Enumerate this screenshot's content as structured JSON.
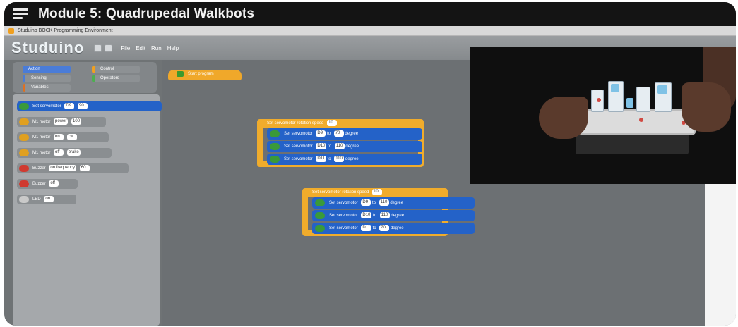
{
  "video": {
    "title": "Module 5: Quadrupedal Walkbots"
  },
  "window": {
    "caption": "Studuino BOCK Programming Environment"
  },
  "toolbar": {
    "brand": "Studuino",
    "menus": [
      "File",
      "Edit",
      "Run",
      "Help"
    ]
  },
  "palette": {
    "categories": [
      "Action",
      "Control",
      "Sensing",
      "Operators",
      "Variables"
    ],
    "blocks": [
      {
        "label": "Set servomotor",
        "slot1": "D9",
        "slot2": "90"
      },
      {
        "label": "M1 motor",
        "slot1": "power",
        "slot2": "100"
      },
      {
        "label": "M1 motor",
        "slot1": "on",
        "slot2": "cw"
      },
      {
        "label": "M1 motor",
        "slot1": "off",
        "slot2": "brake"
      },
      {
        "label": "Buzzer",
        "slot1": "on frequency",
        "slot2": "60"
      },
      {
        "label": "Buzzer",
        "slot1": "off",
        "slot2": ""
      },
      {
        "label": "LED",
        "slot1": "on",
        "slot2": ""
      }
    ]
  },
  "script": {
    "start_label": "Start program",
    "loop1": {
      "label": "Set servomotor rotation speed",
      "value": "10",
      "servos": [
        {
          "label": "Set servomotor",
          "port": "D9",
          "to": "to",
          "angle": "70",
          "unit": "degree"
        },
        {
          "label": "Set servomotor",
          "port": "D10",
          "to": "to",
          "angle": "110",
          "unit": "degree"
        },
        {
          "label": "Set servomotor",
          "port": "D11",
          "to": "to",
          "angle": "110",
          "unit": "degree"
        }
      ]
    },
    "loop2": {
      "label": "Set servomotor rotation speed",
      "value": "10",
      "servos": [
        {
          "label": "Set servomotor",
          "port": "D9",
          "to": "to",
          "angle": "110",
          "unit": "degree"
        },
        {
          "label": "Set servomotor",
          "port": "D10",
          "to": "to",
          "angle": "110",
          "unit": "degree"
        },
        {
          "label": "Set servomotor",
          "port": "D11",
          "to": "to",
          "angle": "70",
          "unit": "degree"
        }
      ]
    }
  }
}
